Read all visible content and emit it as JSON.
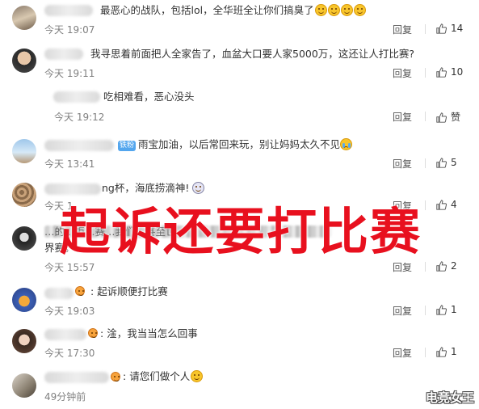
{
  "actions": {
    "reply": "回复",
    "like": "赞"
  },
  "comments": [
    {
      "text": "最恶心的战队，包括lol，全华班全让你们搞臭了",
      "time": "今天 19:07",
      "likes": "14"
    },
    {
      "text": "我寻思着前面把人全家告了，血盆大口要人家5000万，这还让人打比赛?",
      "time": "今天 19:11",
      "likes": "10"
    },
    {
      "text": "吃相难看，恶心没头",
      "time": "今天 19:12",
      "likes": ""
    },
    {
      "badge": "铁粉",
      "text": "雨宝加油，以后常回来玩，别让妈妈太久不见",
      "time": "今天 13:41",
      "likes": "5"
    },
    {
      "text": "ng杯，海底捞滴神!",
      "time": "今天 1",
      "likes": "4"
    },
    {
      "text": "…的…拒…赛…我们…甚至世",
      "text2": "界赛。",
      "time": "今天 15:57",
      "likes": "2"
    },
    {
      "text": "起诉顺便打比赛",
      "time": "今天 19:03",
      "likes": "1"
    },
    {
      "text": "淦，我当当怎么回事",
      "time": "今天 17:30",
      "likes": "1"
    },
    {
      "text": "请您们做个人",
      "time": "49分钟前",
      "likes": ""
    }
  ],
  "overlay_text": "起诉还要打比赛",
  "watermark": "电竞女王",
  "colors": {
    "overlay": "#e8101e",
    "badge": "#53a6ee"
  }
}
